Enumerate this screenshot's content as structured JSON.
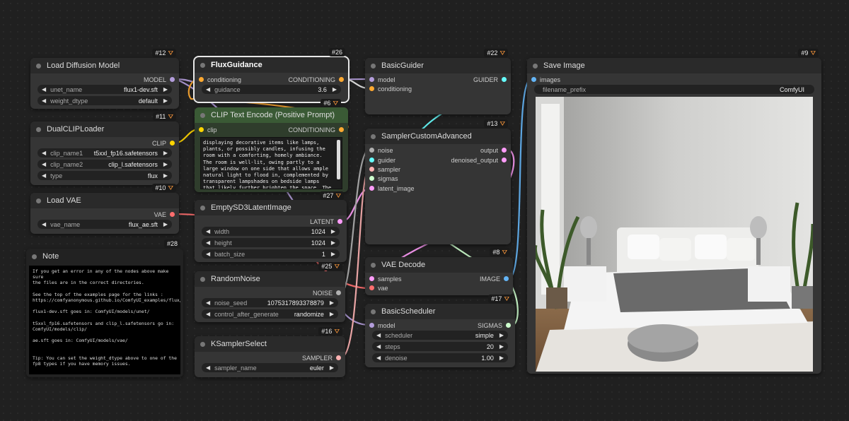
{
  "colors": {
    "model": "#b39ddb",
    "conditioning": "#ffa931",
    "clip": "#ffd500",
    "vae": "#ff6e6e",
    "latent": "#ff9cf9",
    "noise": "#b0b0b0",
    "guider": "#66ffff",
    "sampler": "#ffb3b3",
    "sigmas": "#cdffcd",
    "image": "#64b5f6"
  },
  "nodes": {
    "load_diffusion": {
      "id": "#12",
      "title": "Load Diffusion Model",
      "out_model": "MODEL",
      "w1_name": "unet_name",
      "w1_val": "flux1-dev.sft",
      "w2_name": "weight_dtype",
      "w2_val": "default"
    },
    "dual_clip": {
      "id": "#11",
      "title": "DualCLIPLoader",
      "out_clip": "CLIP",
      "w1_name": "clip_name1",
      "w1_val": "t5xxl_fp16.safetensors",
      "w2_name": "clip_name2",
      "w2_val": "clip_l.safetensors",
      "w3_name": "type",
      "w3_val": "flux"
    },
    "load_vae": {
      "id": "#10",
      "title": "Load VAE",
      "out_vae": "VAE",
      "w1_name": "vae_name",
      "w1_val": "flux_ae.sft"
    },
    "note": {
      "id": "#28",
      "title": "Note",
      "text": "If you get an error in any of the nodes above make sure\nthe files are in the correct directories.\n\nSee the top of the examples page for the links :\nhttps://comfyanonymous.github.io/ComfyUI_examples/flux/\n\nflux1-dev.sft goes in: ComfyUI/models/unet/\n\nt5xxl_fp16.safetensors and clip_l.safetensors go in:\nComfyUI/models/clip/\n\nae.sft goes in: ComfyUI/models/vae/\n\n\nTip: You can set the weight_dtype above to one of the\nfp8 types if you have memory issues."
    },
    "flux_guidance": {
      "id": "#26",
      "title": "FluxGuidance",
      "in_cond": "conditioning",
      "out_cond": "CONDITIONING",
      "w1_name": "guidance",
      "w1_val": "3.6"
    },
    "clip_text": {
      "id": "#6",
      "title": "CLIP Text Encode (Positive Prompt)",
      "in_clip": "clip",
      "out_cond": "CONDITIONING",
      "text": "displaying decorative items like lamps, plants, or possibly candles, infusing the room with a comforting, homely ambiance. The room is well-lit, owing partly to a large window on one side that allows ample natural light to flood in, complemented by transparent lampshades on bedside lamps that likely further brighten the space. The walls exhibit a soft, light gray tone, contributing to the tranquil feel, while a wooden floor provides"
    },
    "empty_latent": {
      "id": "#27",
      "title": "EmptySD3LatentImage",
      "out_latent": "LATENT",
      "w1_name": "width",
      "w1_val": "1024",
      "w2_name": "height",
      "w2_val": "1024",
      "w3_name": "batch_size",
      "w3_val": "1"
    },
    "random_noise": {
      "id": "#25",
      "title": "RandomNoise",
      "out_noise": "NOISE",
      "w1_name": "noise_seed",
      "w1_val": "1075317893378879",
      "w2_name": "control_after_generate",
      "w2_val": "randomize"
    },
    "ksampler_select": {
      "id": "#16",
      "title": "KSamplerSelect",
      "out_sampler": "SAMPLER",
      "w1_name": "sampler_name",
      "w1_val": "euler"
    },
    "basic_guider": {
      "id": "#22",
      "title": "BasicGuider",
      "in_model": "model",
      "in_cond": "conditioning",
      "out_guider": "GUIDER"
    },
    "sampler_custom": {
      "id": "#13",
      "title": "SamplerCustomAdvanced",
      "in_noise": "noise",
      "in_guider": "guider",
      "in_sampler": "sampler",
      "in_sigmas": "sigmas",
      "in_latent": "latent_image",
      "out_output": "output",
      "out_denoised": "denoised_output"
    },
    "vae_decode": {
      "id": "#8",
      "title": "VAE Decode",
      "in_samples": "samples",
      "in_vae": "vae",
      "out_image": "IMAGE"
    },
    "basic_scheduler": {
      "id": "#17",
      "title": "BasicScheduler",
      "in_model": "model",
      "out_sigmas": "SIGMAS",
      "w1_name": "scheduler",
      "w1_val": "simple",
      "w2_name": "steps",
      "w2_val": "20",
      "w3_name": "denoise",
      "w3_val": "1.00"
    },
    "save_image": {
      "id": "#9",
      "title": "Save Image",
      "in_images": "images",
      "w1_name": "filename_prefix",
      "w1_val": "ComfyUI"
    }
  }
}
